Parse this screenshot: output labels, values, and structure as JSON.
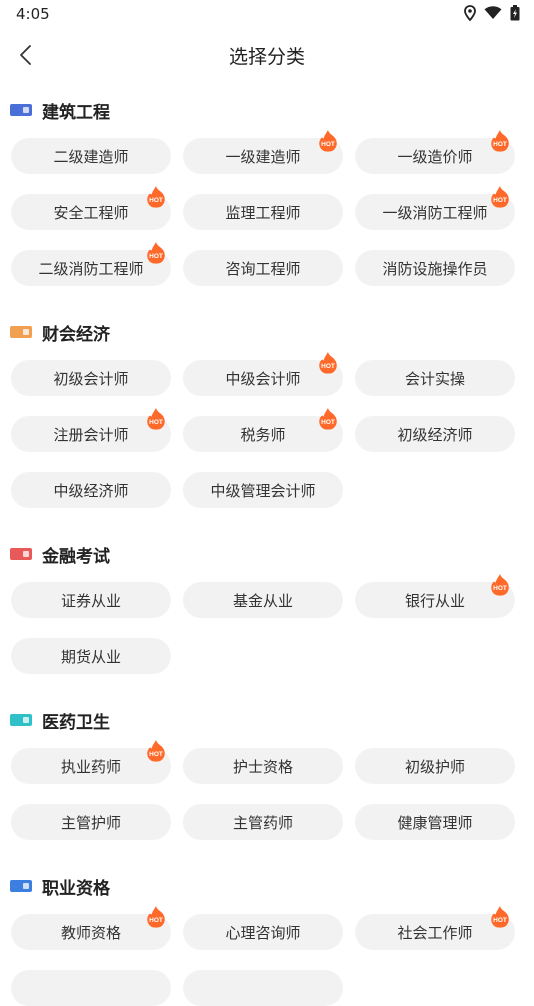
{
  "status_bar": {
    "time": "4:05"
  },
  "nav": {
    "title": "选择分类"
  },
  "sections": [
    {
      "title": "建筑工程",
      "icon_color": "#4a6fd8",
      "items": [
        {
          "label": "二级建造师",
          "hot": false
        },
        {
          "label": "一级建造师",
          "hot": true
        },
        {
          "label": "一级造价师",
          "hot": true
        },
        {
          "label": "安全工程师",
          "hot": true
        },
        {
          "label": "监理工程师",
          "hot": false
        },
        {
          "label": "一级消防工程师",
          "hot": true
        },
        {
          "label": "二级消防工程师",
          "hot": true
        },
        {
          "label": "咨询工程师",
          "hot": false
        },
        {
          "label": "消防设施操作员",
          "hot": false
        }
      ]
    },
    {
      "title": "财会经济",
      "icon_color": "#f0a050",
      "items": [
        {
          "label": "初级会计师",
          "hot": false
        },
        {
          "label": "中级会计师",
          "hot": true
        },
        {
          "label": "会计实操",
          "hot": false
        },
        {
          "label": "注册会计师",
          "hot": true
        },
        {
          "label": "税务师",
          "hot": true
        },
        {
          "label": "初级经济师",
          "hot": false
        },
        {
          "label": "中级经济师",
          "hot": false
        },
        {
          "label": "中级管理会计师",
          "hot": false
        }
      ]
    },
    {
      "title": "金融考试",
      "icon_color": "#e85a5a",
      "items": [
        {
          "label": "证券从业",
          "hot": false
        },
        {
          "label": "基金从业",
          "hot": false
        },
        {
          "label": "银行从业",
          "hot": true
        },
        {
          "label": "期货从业",
          "hot": false
        }
      ]
    },
    {
      "title": "医药卫生",
      "icon_color": "#2fc0c8",
      "items": [
        {
          "label": "执业药师",
          "hot": true
        },
        {
          "label": "护士资格",
          "hot": false
        },
        {
          "label": "初级护师",
          "hot": false
        },
        {
          "label": "主管护师",
          "hot": false
        },
        {
          "label": "主管药师",
          "hot": false
        },
        {
          "label": "健康管理师",
          "hot": false
        }
      ]
    },
    {
      "title": "职业资格",
      "icon_color": "#3d7fe0",
      "items": [
        {
          "label": "教师资格",
          "hot": true
        },
        {
          "label": "心理咨询师",
          "hot": false
        },
        {
          "label": "社会工作师",
          "hot": true
        },
        {
          "label": "",
          "hot": false
        },
        {
          "label": "",
          "hot": false
        }
      ]
    }
  ],
  "hot_badge": {
    "text": "HOT",
    "color": "#ff6a2b"
  }
}
